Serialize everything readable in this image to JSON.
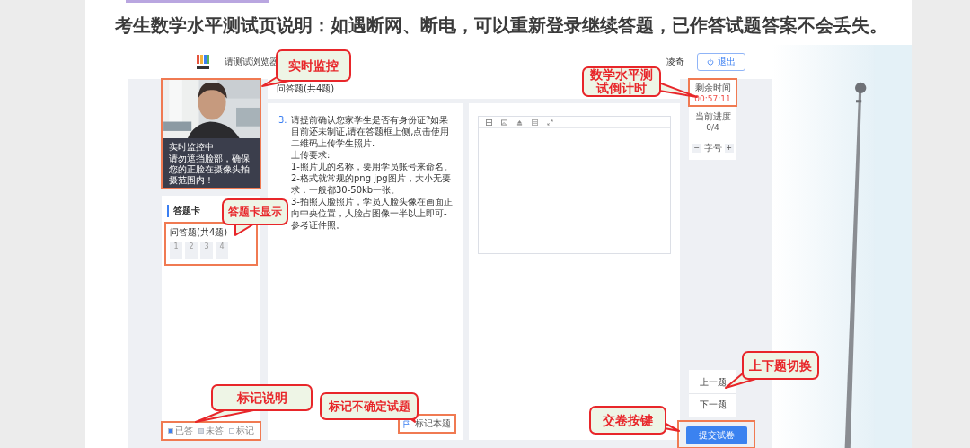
{
  "heading": "考生数学水平测试页说明：如遇断网、断电，可以重新登录继续答题，已作答试题答案不会丢失。",
  "app": {
    "title": "请测试浏览器",
    "user": "凌奇",
    "exit_button": "退出"
  },
  "monitor": {
    "status": "实时监控中",
    "hint": "请勿遮挡脸部，确保您的正脸在摄像头拍摄范围内！"
  },
  "answer_card": {
    "title": "答题卡",
    "section": "问答题(共4题)",
    "questions": [
      {
        "number": "1",
        "answered": false
      },
      {
        "number": "2",
        "answered": false
      },
      {
        "number": "3",
        "answered": false
      },
      {
        "number": "4",
        "answered": false
      }
    ],
    "legend": [
      {
        "label": "已答",
        "kind": "answered"
      },
      {
        "label": "未答",
        "kind": "unanswered"
      },
      {
        "label": "标记",
        "kind": "marked"
      }
    ]
  },
  "section_title": "问答题(共4题)",
  "question": {
    "number": "3.",
    "lines": [
      "请提前确认您家学生是否有身份证?如果目前还未制证,请在答题框上侧,点击使用二维码上传学生照片.",
      "上传要求:",
      "1-照片儿的名称，要用学员账号来命名。",
      "2-格式就常规的png jpg图片，大小无要求：一般都30-50kb一张。",
      "3-拍照人脸照片，学员人脸头像在画面正向中央位置，人脸占图像一半以上即可-参考证件照。"
    ],
    "mark_button": "标记本题"
  },
  "timer": {
    "label": "剩余时间",
    "value": "00:57:11"
  },
  "progress": {
    "label": "当前进度",
    "value": "0/4"
  },
  "font_size": {
    "decrease": "−",
    "label": "字号",
    "increase": "+"
  },
  "nav": {
    "prev": "上一题",
    "next": "下一题"
  },
  "submit_button": "提交试卷",
  "callouts": [
    "实时监控",
    "答题卡显示",
    "数学水平测试倒计时",
    "标记说明",
    "标记不确定试题",
    "上下题切换",
    "交卷按键"
  ]
}
